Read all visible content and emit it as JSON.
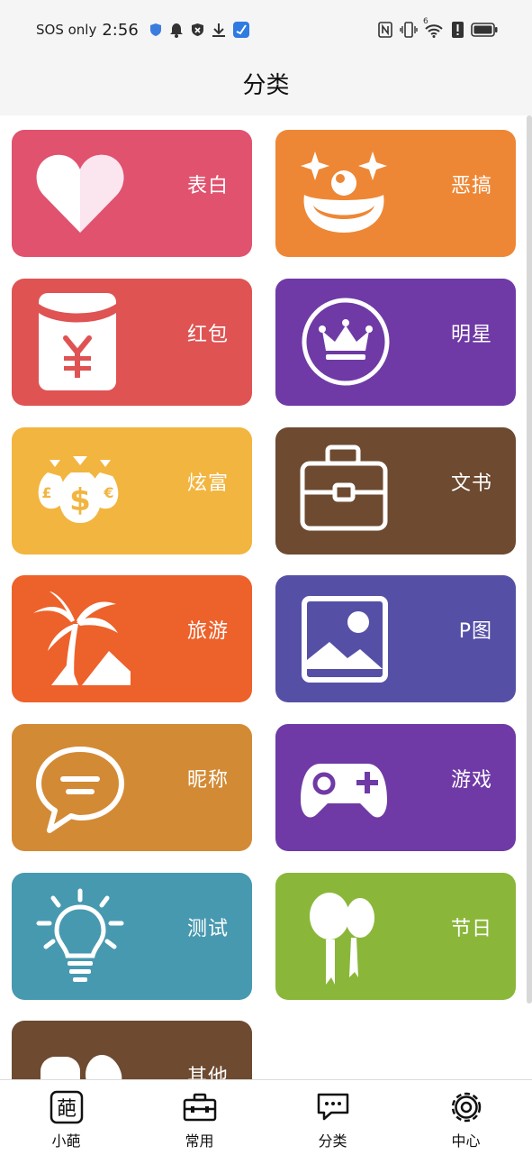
{
  "status_bar": {
    "carrier": "SOS only",
    "time": "2:56",
    "signal_label": "6"
  },
  "header": {
    "title": "分类"
  },
  "categories": [
    {
      "label": "表白",
      "color": "#e0526e",
      "icon": "heart-icon"
    },
    {
      "label": "恶搞",
      "color": "#ee8735",
      "icon": "clown-face-icon"
    },
    {
      "label": "红包",
      "color": "#df5353",
      "icon": "red-envelope-icon"
    },
    {
      "label": "明星",
      "color": "#6f3aa6",
      "icon": "crown-icon"
    },
    {
      "label": "炫富",
      "color": "#f2b53f",
      "icon": "money-bags-icon"
    },
    {
      "label": "文书",
      "color": "#6d4a30",
      "icon": "briefcase-icon"
    },
    {
      "label": "旅游",
      "color": "#ed612a",
      "icon": "palm-tree-icon"
    },
    {
      "label": "P图",
      "color": "#5550a6",
      "icon": "picture-icon"
    },
    {
      "label": "昵称",
      "color": "#d38a35",
      "icon": "speech-bubble-icon"
    },
    {
      "label": "游戏",
      "color": "#6f3aa6",
      "icon": "gamepad-icon"
    },
    {
      "label": "测试",
      "color": "#4799b0",
      "icon": "lightbulb-icon"
    },
    {
      "label": "节日",
      "color": "#8ab73a",
      "icon": "balloons-icon"
    },
    {
      "label": "其他",
      "color": "#6d4a30",
      "icon": "blobs-icon"
    }
  ],
  "tabs": [
    {
      "label": "小葩",
      "icon": "pa-character-icon"
    },
    {
      "label": "常用",
      "icon": "toolbox-icon"
    },
    {
      "label": "分类",
      "icon": "chat-bubbles-icon"
    },
    {
      "label": "中心",
      "icon": "gear-icon"
    }
  ]
}
